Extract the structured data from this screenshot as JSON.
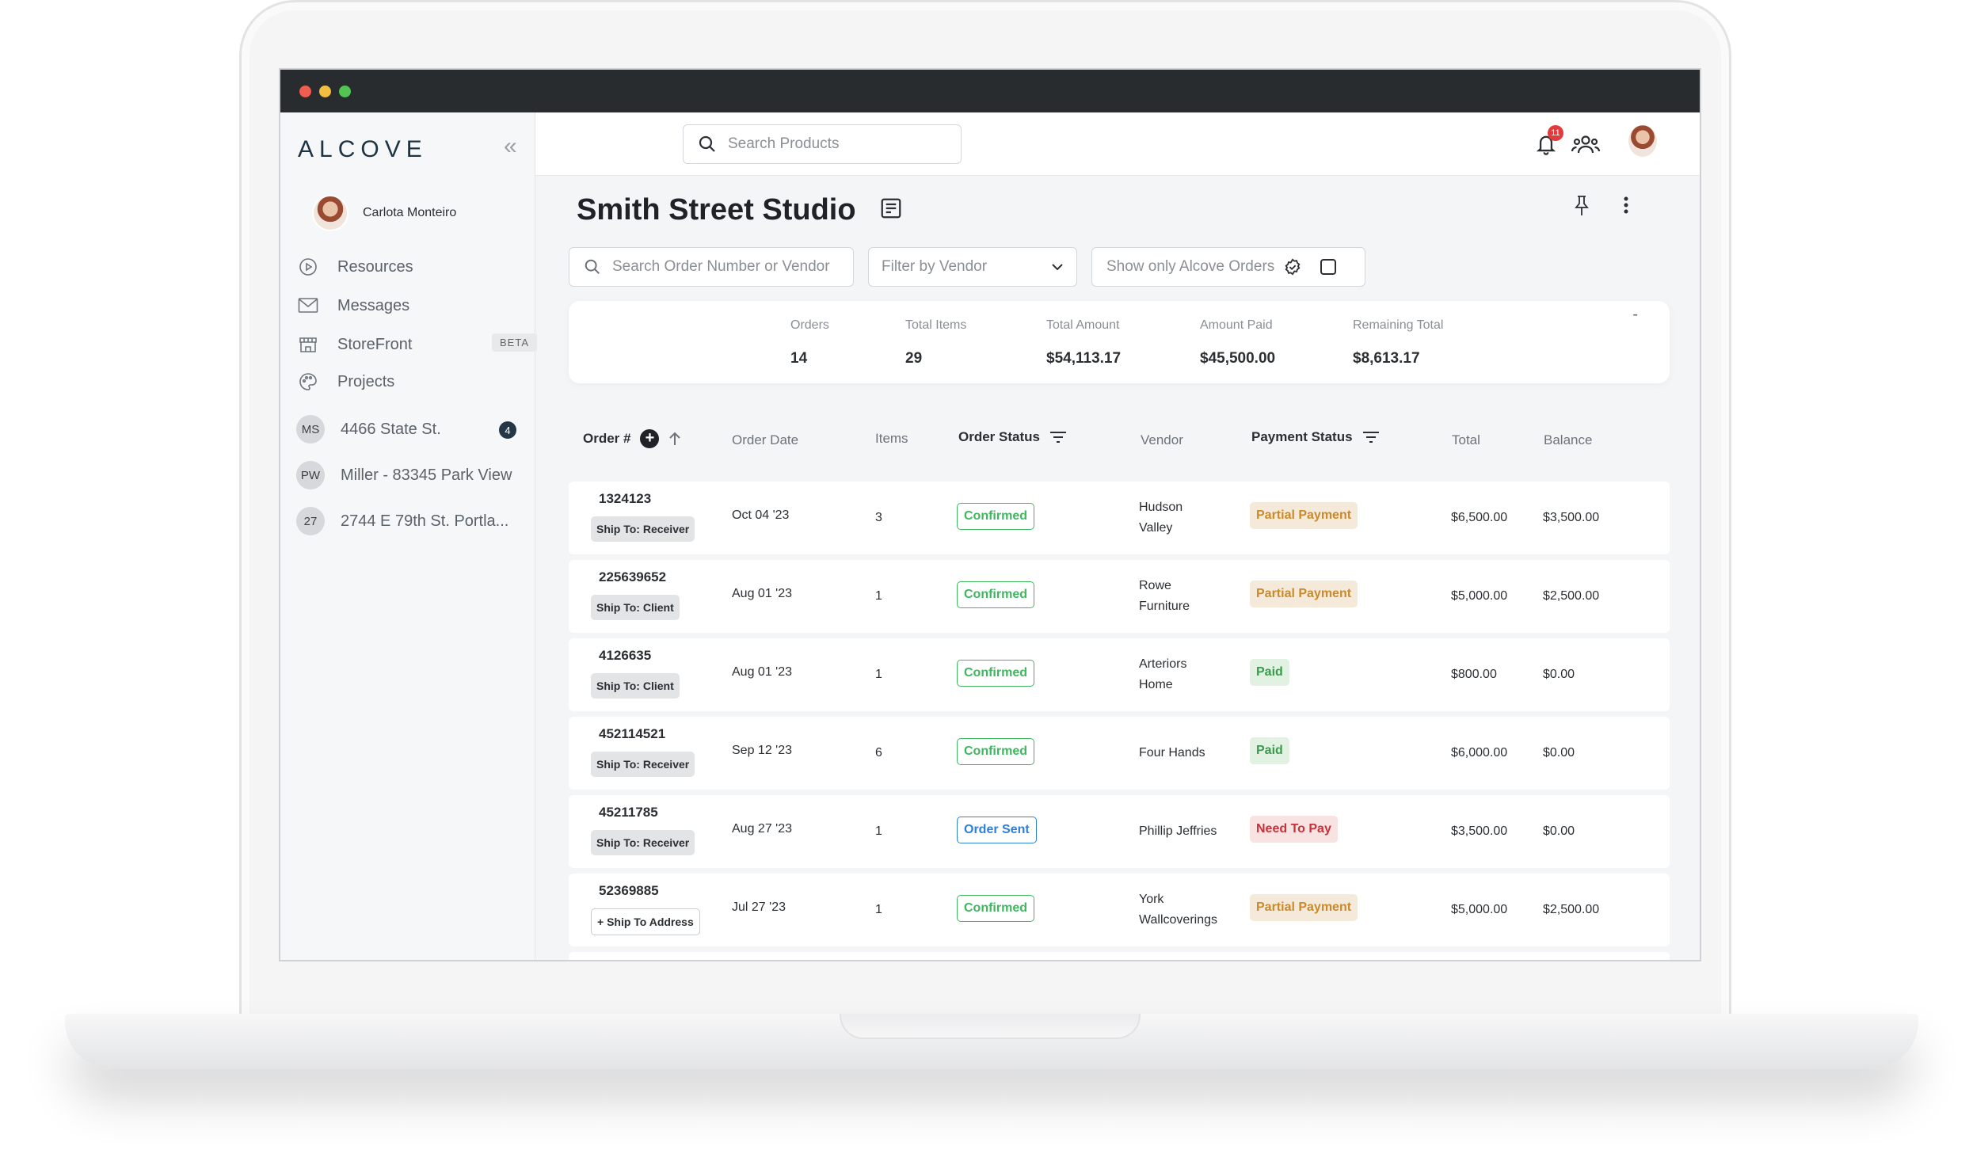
{
  "app": {
    "logo": "ALCOVE",
    "user_name": "Carlota Monteiro",
    "nav": [
      {
        "label": "Resources",
        "icon": "play-circle-icon"
      },
      {
        "label": "Messages",
        "icon": "mail-icon"
      },
      {
        "label": "StoreFront",
        "icon": "storefront-icon",
        "badge": "BETA"
      },
      {
        "label": "Projects",
        "icon": "palette-icon"
      }
    ],
    "projects": [
      {
        "initials": "MS",
        "label": "4466 State St.",
        "count": "4"
      },
      {
        "initials": "PW",
        "label": "Miller - 83345 Park View"
      },
      {
        "initials": "27",
        "label": "2744 E 79th St. Portla..."
      }
    ]
  },
  "topbar": {
    "search_placeholder": "Search Products",
    "notification_count": "11"
  },
  "page": {
    "title": "Smith Street Studio",
    "filters": {
      "search_placeholder": "Search Order Number or Vendor",
      "vendor_label": "Filter by Vendor",
      "alcove_toggle_label": "Show only Alcove Orders"
    },
    "summary": [
      {
        "label": "Orders",
        "value": "14"
      },
      {
        "label": "Total Items",
        "value": "29"
      },
      {
        "label": "Total Amount",
        "value": "$54,113.17"
      },
      {
        "label": "Amount Paid",
        "value": "$45,500.00"
      },
      {
        "label": "Remaining Total",
        "value": "$8,613.17"
      }
    ],
    "summary_collapse": "-",
    "columns": {
      "order": "Order #",
      "date": "Order Date",
      "items": "Items",
      "status": "Order Status",
      "vendor": "Vendor",
      "payment": "Payment Status",
      "total": "Total",
      "balance": "Balance"
    },
    "orders": [
      {
        "number": "1324123",
        "ship": "Ship To: Receiver",
        "date": "Oct 04 '23",
        "items": "3",
        "status": "Confirmed",
        "vendor1": "Hudson",
        "vendor2": "Valley",
        "payment": "Partial Payment",
        "total": "$6,500.00",
        "balance": "$3,500.00"
      },
      {
        "number": "225639652",
        "ship": "Ship To: Client",
        "date": "Aug 01 '23",
        "items": "1",
        "status": "Confirmed",
        "vendor1": "Rowe",
        "vendor2": "Furniture",
        "payment": "Partial Payment",
        "total": "$5,000.00",
        "balance": "$2,500.00"
      },
      {
        "number": "4126635",
        "ship": "Ship To: Client",
        "date": "Aug 01 '23",
        "items": "1",
        "status": "Confirmed",
        "vendor1": "Arteriors",
        "vendor2": "Home",
        "payment": "Paid",
        "total": "$800.00",
        "balance": "$0.00"
      },
      {
        "number": "452114521",
        "ship": "Ship To: Receiver",
        "date": "Sep 12 '23",
        "items": "6",
        "status": "Confirmed",
        "vendor1": "Four Hands",
        "vendor2": "",
        "payment": "Paid",
        "total": "$6,000.00",
        "balance": "$0.00"
      },
      {
        "number": "45211785",
        "ship": "Ship To: Receiver",
        "date": "Aug 27 '23",
        "items": "1",
        "status": "Order Sent",
        "vendor1": "Phillip Jeffries",
        "vendor2": "",
        "payment": "Need To Pay",
        "total": "$3,500.00",
        "balance": "$0.00"
      },
      {
        "number": "52369885",
        "ship": "+ Ship To Address",
        "date": "Jul 27 '23",
        "items": "1",
        "status": "Confirmed",
        "vendor1": "York",
        "vendor2": "Wallcoverings",
        "payment": "Partial Payment",
        "total": "$5,000.00",
        "balance": "$2,500.00"
      }
    ]
  },
  "colors": {
    "confirmed": "#3db85f",
    "order_sent": "#2f7fd8",
    "partial": "#c98a2c",
    "paid": "#3a9b4c",
    "need_to_pay": "#c6323a",
    "brand_dark": "#1d3442"
  }
}
